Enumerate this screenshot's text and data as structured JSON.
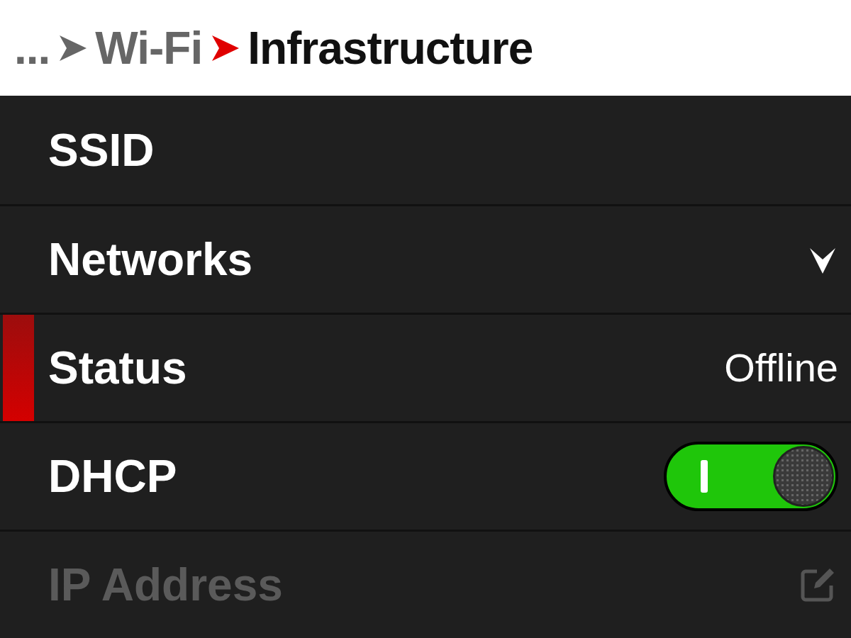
{
  "breadcrumb": [
    {
      "label": "...",
      "current": false
    },
    {
      "label": "Wi-Fi",
      "current": false
    },
    {
      "label": "Infrastructure",
      "current": true
    }
  ],
  "rows": [
    {
      "kind": "plain",
      "label": "SSID",
      "selected": false,
      "disabled": false
    },
    {
      "kind": "dropdown",
      "label": "Networks",
      "selected": false,
      "disabled": false
    },
    {
      "kind": "value",
      "label": "Status",
      "value": "Offline",
      "selected": true,
      "disabled": false
    },
    {
      "kind": "toggle",
      "label": "DHCP",
      "on": true,
      "selected": false,
      "disabled": false
    },
    {
      "kind": "edit",
      "label": "IP Address",
      "selected": false,
      "disabled": true
    }
  ]
}
